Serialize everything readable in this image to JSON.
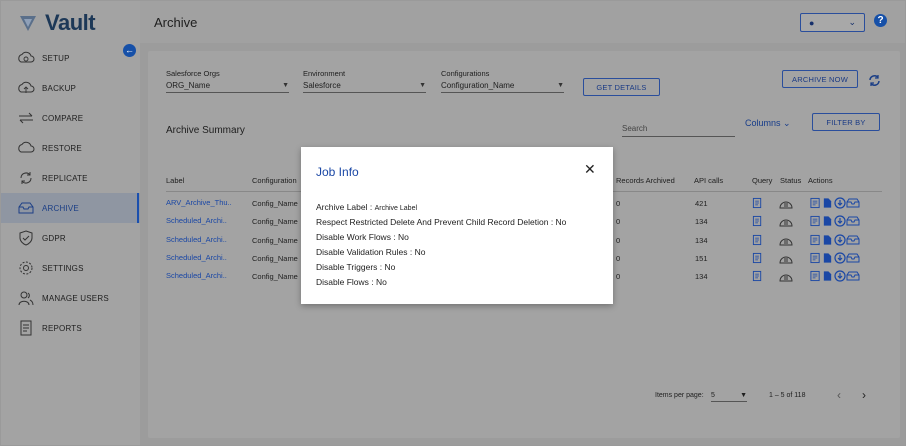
{
  "app": {
    "logo_text": "Vault"
  },
  "sidebar": {
    "items": [
      {
        "label": "SETUP",
        "icon": "cloud-gear-icon"
      },
      {
        "label": "BACKUP",
        "icon": "cloud-upload-icon"
      },
      {
        "label": "COMPARE",
        "icon": "compare-arrows-icon"
      },
      {
        "label": "RESTORE",
        "icon": "cloud-restore-icon"
      },
      {
        "label": "REPLICATE",
        "icon": "replicate-icon"
      },
      {
        "label": "ARCHIVE",
        "icon": "archive-icon",
        "active": true
      },
      {
        "label": "GDPR",
        "icon": "shield-check-icon"
      },
      {
        "label": "SETTINGS",
        "icon": "gear-icon"
      },
      {
        "label": "MANAGE USERS",
        "icon": "users-icon"
      },
      {
        "label": "REPORTS",
        "icon": "report-icon"
      }
    ]
  },
  "header": {
    "title": "Archive",
    "user_icon": "person-icon",
    "help": "?"
  },
  "filters": {
    "orgs": {
      "label": "Salesforce Orgs",
      "value": "ORG_Name"
    },
    "env": {
      "label": "Environment",
      "value": "Salesforce"
    },
    "config": {
      "label": "Configurations",
      "value": "Configuration_Name"
    },
    "get_details": "GET DETAILS",
    "archive_now": "ARCHIVE NOW"
  },
  "summary": {
    "title": "Archive Summary",
    "search_placeholder": "Search",
    "columns_label": "Columns",
    "filter_by": "FILTER BY"
  },
  "table": {
    "headers": {
      "label": "Label",
      "configuration": "Configuration",
      "records_archived": "Records Archived",
      "api_calls": "API calls",
      "query": "Query",
      "status": "Status",
      "actions": "Actions"
    },
    "rows": [
      {
        "label": "ARV_Archive_Thu..",
        "config": "Config_Name",
        "records": "0",
        "api": "421"
      },
      {
        "label": "Scheduled_Archi..",
        "config": "Config_Name",
        "records": "0",
        "api": "134"
      },
      {
        "label": "Scheduled_Archi..",
        "config": "Config_Name",
        "records": "0",
        "api": "134"
      },
      {
        "label": "Scheduled_Archi..",
        "config": "Config_Name",
        "records": "0",
        "api": "151"
      },
      {
        "label": "Scheduled_Archi..",
        "config": "Config_Name",
        "records": "0",
        "api": "134"
      }
    ]
  },
  "pagination": {
    "items_per_page_label": "Items per page:",
    "items_per_page": "5",
    "range": "1 – 5 of 118",
    "prev": "‹",
    "next": "›"
  },
  "modal": {
    "title": "Job Info",
    "close": "✕",
    "archive_label_key": "Archive Label :",
    "archive_label_value": "Archive Label",
    "lines": [
      "Respect Restricted Delete And Prevent Child Record Deletion : No",
      "Disable Work Flows : No",
      "Disable Validation Rules : No",
      "Disable Triggers : No",
      "Disable Flows : No"
    ]
  },
  "colors": {
    "accent": "#1a47a5",
    "overlay": "#9e9e9e"
  }
}
